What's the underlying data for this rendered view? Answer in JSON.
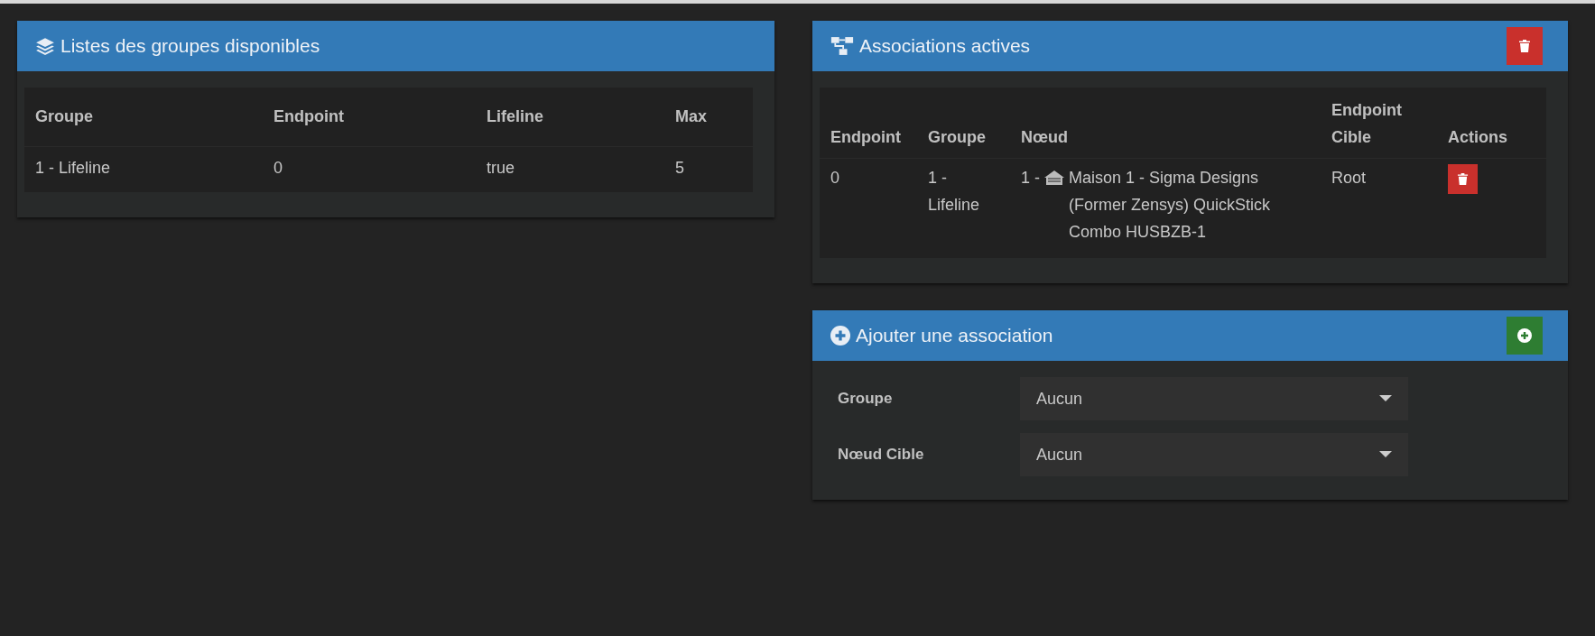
{
  "groups_panel": {
    "title": "Listes des groupes disponibles",
    "columns": [
      "Groupe",
      "Endpoint",
      "Lifeline",
      "Max"
    ],
    "rows": [
      [
        "1 - Lifeline",
        "0",
        "true",
        "5"
      ]
    ]
  },
  "associations_panel": {
    "title": "Associations actives",
    "columns": [
      "Endpoint",
      "Groupe",
      "Nœud",
      "Endpoint Cible",
      "Actions"
    ],
    "rows": [
      {
        "endpoint": "0",
        "group": "1 - Lifeline",
        "node_prefix": "1 -",
        "node_name": "Maison 1 - Sigma Designs (Former Zensys) QuickStick Combo HUSBZB-1",
        "target_endpoint": "Root"
      }
    ]
  },
  "add_panel": {
    "title": "Ajouter une association",
    "fields": [
      {
        "label": "Groupe",
        "value": "Aucun"
      },
      {
        "label": "Nœud Cible",
        "value": "Aucun"
      }
    ]
  }
}
